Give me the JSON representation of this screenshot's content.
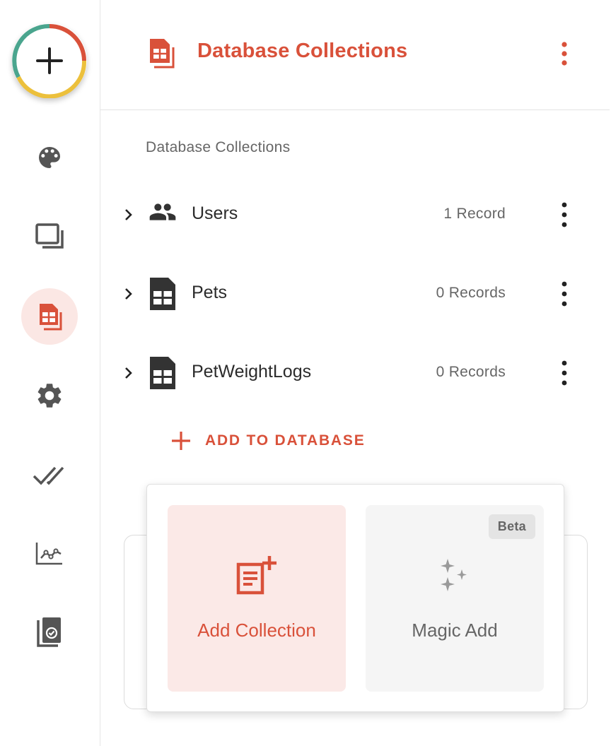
{
  "header": {
    "title": "Database Collections"
  },
  "section": {
    "label": "Database Collections"
  },
  "collections": [
    {
      "name": "Users",
      "count": "1 Record",
      "icon": "users-icon"
    },
    {
      "name": "Pets",
      "count": "0 Records",
      "icon": "sheet-icon"
    },
    {
      "name": "PetWeightLogs",
      "count": "0 Records",
      "icon": "sheet-icon"
    }
  ],
  "actions": {
    "add_to_database": "ADD TO DATABASE"
  },
  "popup": {
    "add_collection": "Add Collection",
    "magic_add": "Magic Add",
    "beta": "Beta"
  },
  "sidebar": {
    "items": [
      "add-icon",
      "palette-icon",
      "pages-icon",
      "database-icon",
      "gear-icon",
      "done-all-icon",
      "analytics-icon",
      "testing-icon"
    ],
    "active": "database-icon"
  },
  "colors": {
    "accent": "#d9513a",
    "accent_light": "#fbe7e4",
    "icon_gray": "#555555"
  }
}
